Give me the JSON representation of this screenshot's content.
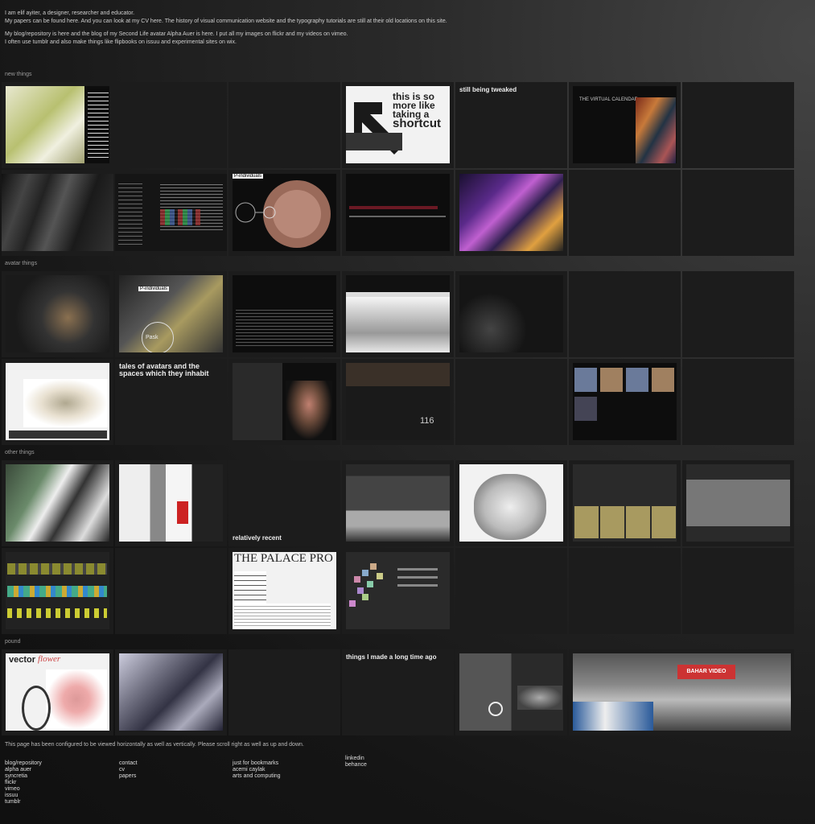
{
  "intro": {
    "line1": "I am elif ayiter, a designer, researcher and educator.",
    "line2": "My papers can be found here. And you can look at my CV here. The history of visual communication website and the typography tutorials are still at their old locations on this site.",
    "line3": "My blog/repository is here and the blog of my Second Life avatar Alpha Auer is here. I put all my images on flickr and my videos on vimeo.",
    "line4": "I often use tumblr and also make things like flipbooks on issuu and experimental sites on wix."
  },
  "sections": {
    "new_things": "new things",
    "avatar_things": "avatar things",
    "other_things": "other things",
    "pound": "pound"
  },
  "captions": {
    "still_tweaked": "still being tweaked",
    "avatars": "tales of avatars and the spaces which they inhabit",
    "relatively_recent": "relatively recent",
    "long_ago": "things I made a long time ago"
  },
  "thumb_text": {
    "shortcut_a": "this is so",
    "shortcut_b": "more like",
    "shortcut_c": "taking a",
    "shortcut_d": "shortcut",
    "calendar": "THE VIRTUAL CALENDAR",
    "pindividuals": "P-individuals",
    "palace_title": "THE PALACE PRO",
    "vector": "vector",
    "flower": "flower",
    "bahar": "BAHAR VIDEO",
    "num116": "116",
    "pask": "Pask"
  },
  "note": "This page has been configured to be viewed horizontally as well as vertically. Please scroll right as well as up and down.",
  "links": {
    "col1": [
      "blog/repository",
      "alpha auer",
      "syncretia",
      "flickr",
      "vimeo",
      "issuu",
      "tumblr"
    ],
    "col2": [
      "contact",
      "cv",
      "papers"
    ],
    "col3": [
      "just for bookmarks",
      "acemi caylak",
      "arts and computing"
    ],
    "col4": [
      "linkedin",
      "behance"
    ]
  }
}
